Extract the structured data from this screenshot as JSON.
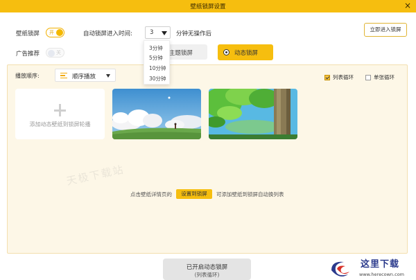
{
  "window": {
    "title": "壁纸锁屏设置",
    "close_symbol": "×"
  },
  "settings": {
    "wallpaper_lock_label": "壁纸锁屏",
    "wallpaper_lock_toggle_text": "开",
    "auto_lock_label": "自动锁屏进入时间:",
    "auto_lock_value": "3",
    "auto_lock_suffix": "分钟无操作后",
    "auto_lock_options": [
      "3分钟",
      "5分钟",
      "10分钟",
      "30分钟"
    ],
    "ads_label": "广告推荐",
    "ads_toggle_text": "关",
    "lock_now_button": "立即进入锁屏"
  },
  "mode_tabs": {
    "theme": "主题锁屏",
    "dynamic": "动态锁屏"
  },
  "panel": {
    "order_label": "播放顺序:",
    "order_value": "顺序播放",
    "list_loop_label": "列表循环",
    "single_loop_label": "单张循环",
    "add_card_text": "添加动态壁纸到锁屏轮播",
    "watermark": "天极下载站",
    "hint_prefix": "点击壁纸详情页的",
    "hint_button": "设置到锁屏",
    "hint_suffix": "可添加壁纸到锁屏自动换列表"
  },
  "footer": {
    "enable_line1": "已开启动态锁屏",
    "enable_line2": "(列表循环)",
    "logo_brand": "这里下载",
    "logo_url": "www.herecown.com"
  },
  "colors": {
    "accent": "#f6be0f",
    "panel_bg": "#fdf7e7"
  }
}
